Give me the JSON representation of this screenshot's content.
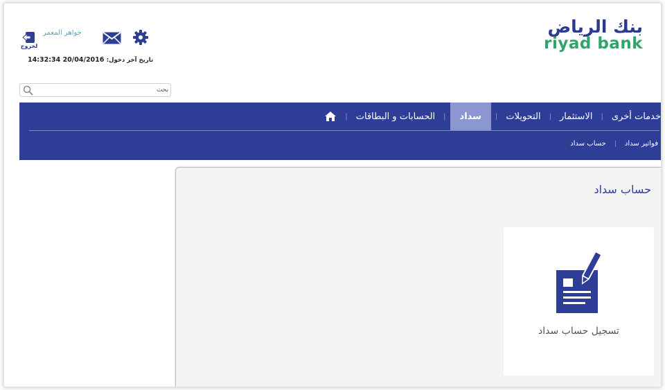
{
  "header": {
    "logo_ar": "بنك الرياض",
    "logo_en": "riyad bank",
    "username": "جواهر المعمر",
    "logout_label": "لخروج",
    "last_login_label": "تاريخ آخر دخول:",
    "last_login_value": "14:32:34 20/04/2016"
  },
  "search": {
    "placeholder": "بحث"
  },
  "nav": {
    "items": [
      {
        "label": "الحسابات و البطاقات"
      },
      {
        "label": "سداد"
      },
      {
        "label": "التحويلات"
      },
      {
        "label": "الاستثمار"
      },
      {
        "label": "خدمات أخرى"
      }
    ],
    "active_index": 1,
    "subitems": [
      {
        "label": "حساب سداد"
      },
      {
        "label": "فواتير سداد"
      }
    ]
  },
  "main": {
    "title": "حساب سداد",
    "card_label": "تسجيل حساب سداد"
  },
  "colors": {
    "nav_bg": "#2e3d96",
    "nav_active": "#8c96d0",
    "logo_blue": "#2b3a8f",
    "logo_green": "#2ea56b",
    "panel_bg": "#f3f3f3"
  },
  "icons": [
    "logout-icon",
    "mail-icon",
    "gear-icon",
    "search-icon",
    "home-icon",
    "register-form-icon"
  ]
}
